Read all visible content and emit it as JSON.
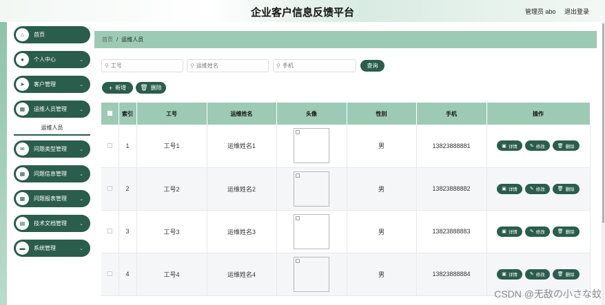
{
  "header": {
    "title": "企业客户信息反馈平台",
    "user": "管理员 abo",
    "logout": "退出登录"
  },
  "sidebar": {
    "items": [
      {
        "label": "首页",
        "icon": "home-icon",
        "glyph": "⌂",
        "has_arrow": false
      },
      {
        "label": "个人中心",
        "icon": "user-icon",
        "glyph": "●",
        "has_arrow": true
      },
      {
        "label": "客户管理",
        "icon": "send-icon",
        "glyph": "➤",
        "has_arrow": true
      },
      {
        "label": "运维人员管理",
        "icon": "grid-icon",
        "glyph": "▦",
        "has_arrow": true
      },
      {
        "label": "问题类型管理",
        "icon": "envelope-icon",
        "glyph": "✉",
        "has_arrow": true
      },
      {
        "label": "问题信息管理",
        "icon": "grid-icon",
        "glyph": "▦",
        "has_arrow": true
      },
      {
        "label": "问题报表管理",
        "icon": "grid-icon",
        "glyph": "▦",
        "has_arrow": true
      },
      {
        "label": "技术文档管理",
        "icon": "table-icon",
        "glyph": "▤",
        "has_arrow": true
      },
      {
        "label": "系统管理",
        "icon": "briefcase-icon",
        "glyph": "▬",
        "has_arrow": true
      }
    ],
    "active_sub": "运维人员"
  },
  "breadcrumb": {
    "home": "首页",
    "current": "运维人员"
  },
  "search": {
    "field1_placeholder": "工号",
    "field2_placeholder": "运维姓名",
    "field3_placeholder": "手机",
    "query_label": "查询"
  },
  "toolbar": {
    "add_label": "新增",
    "delete_label": "删除"
  },
  "table": {
    "headers": [
      "索引",
      "工号",
      "运维姓名",
      "头像",
      "性别",
      "手机",
      "操作"
    ],
    "rows": [
      {
        "index": "1",
        "id": "工号1",
        "name": "运维姓名1",
        "gender": "男",
        "phone": "13823888881"
      },
      {
        "index": "2",
        "id": "工号2",
        "name": "运维姓名2",
        "gender": "男",
        "phone": "13823888882"
      },
      {
        "index": "3",
        "id": "工号3",
        "name": "运维姓名3",
        "gender": "男",
        "phone": "13823888883"
      },
      {
        "index": "4",
        "id": "工号4",
        "name": "运维姓名4",
        "gender": "男",
        "phone": "13823888884"
      }
    ],
    "actions": {
      "detail": "详情",
      "edit": "修改",
      "delete": "删除"
    }
  },
  "watermark": "CSDN @无敌の小さな蚊",
  "colors": {
    "primary": "#2a5d4b",
    "header_green": "#9dcab5",
    "sidebar_green": "#8fc2ab"
  }
}
